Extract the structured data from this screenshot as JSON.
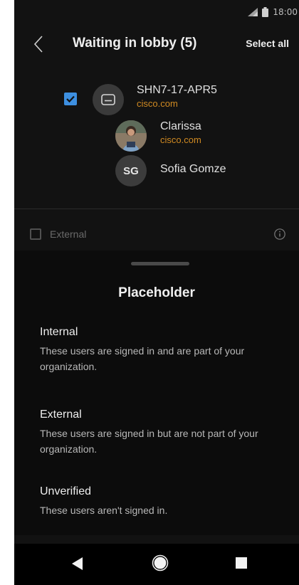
{
  "status_bar": {
    "time": "18:00",
    "icons": [
      "signal-icon",
      "battery-icon"
    ]
  },
  "header": {
    "back_icon": "chevron-left-icon",
    "title": "Waiting in lobby (5)",
    "select_all": "Select all"
  },
  "lobby": {
    "selected_checkbox": true,
    "device": {
      "name": "SHN7-17-APR5",
      "domain": "cisco.com",
      "icon": "device-icon"
    },
    "people": [
      {
        "name": "Clarissa",
        "domain": "cisco.com",
        "avatar": "photo"
      },
      {
        "name": "Sofia Gomze",
        "initials": "SG"
      }
    ]
  },
  "external_row": {
    "label": "External",
    "checked": false,
    "icon": "info-icon"
  },
  "sheet": {
    "title": "Placeholder",
    "sections": [
      {
        "title": "Internal",
        "body": "These users are signed in and are part of your organization."
      },
      {
        "title": "External",
        "body": "These users are signed in but are not part of your organization."
      },
      {
        "title": "Unverified",
        "body": "These users aren't signed in."
      }
    ]
  },
  "nav_bar": {
    "icons": [
      "nav-back-icon",
      "nav-home-icon",
      "nav-recents-icon"
    ]
  },
  "colors": {
    "background": "#121212",
    "accent_checkbox": "#3d8fe0",
    "domain_text": "#d08a22"
  }
}
